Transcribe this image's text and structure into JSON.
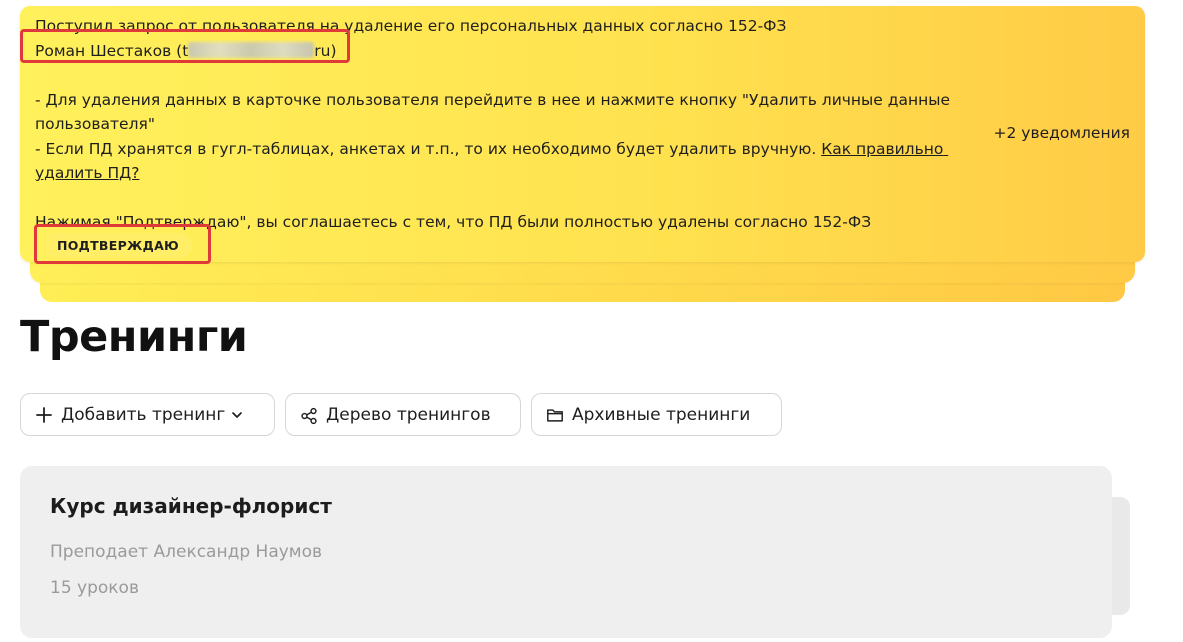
{
  "notification": {
    "line1": "Поступил запрос от пользователя на удаление его персональных данных согласно 152-ФЗ",
    "user_name": "Роман Шестаков",
    "email_visible_start": "t",
    "email_visible_end": "ru",
    "instruction1": "- Для удаления данных в карточке пользователя перейдите в нее и нажмите кнопку \"Удалить личные данные пользователя\"",
    "instruction2_prefix": "- Если ПД хранятся в гугл-таблицах, анкетах и т.п., то их необходимо будет удалить вручную. ",
    "instruction2_link": "Как правильно удалить ПД?",
    "consent": "Нажимая \"Подтверждаю\", вы соглашаетесь с тем, что ПД были полностью удалены согласно 152-ФЗ",
    "confirm_label": "ПОДТВЕРЖДАЮ",
    "more_label": "+2 уведомления"
  },
  "page": {
    "title": "Тренинги"
  },
  "toolbar": {
    "add_label": "Добавить тренинг",
    "tree_label": "Дерево тренингов",
    "archive_label": "Архивные тренинги"
  },
  "training_card": {
    "title": "Курс дизайнер-флорист",
    "teacher": "Преподает Александр Наумов",
    "lessons": "15 уроков"
  },
  "colors": {
    "notice_yellow": "#fff15c",
    "notice_orange": "#ffcb46",
    "highlight_red": "#e0393a",
    "card_bg": "#efefef"
  }
}
